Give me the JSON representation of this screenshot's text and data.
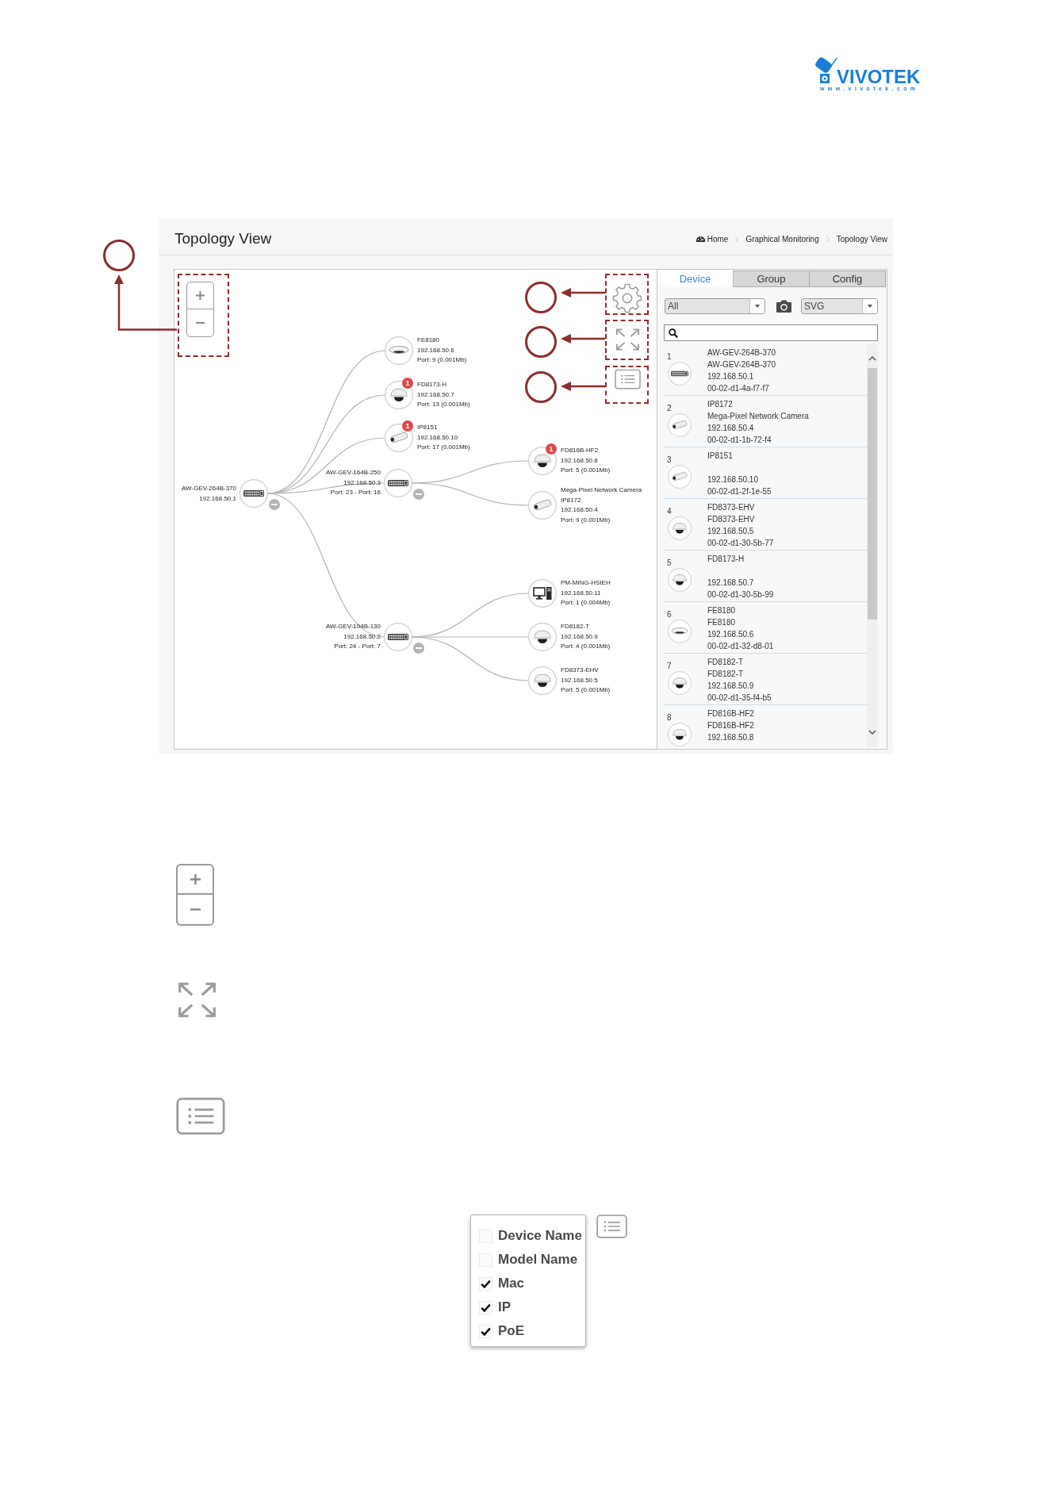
{
  "logo": {
    "wordmark": "VIVOTEK",
    "url": "www.vivotek.com"
  },
  "header": {
    "title": "Topology View",
    "breadcrumb": [
      {
        "label": "Home",
        "kind": "home"
      },
      {
        "label": "Graphical Monitoring",
        "kind": "link"
      },
      {
        "label": "Topology View",
        "kind": "link"
      }
    ]
  },
  "topology": {
    "kind": "switch",
    "name": "AW-GEV-264B-370",
    "ip": "192.168.50.1",
    "expanded": true,
    "children": [
      {
        "kind": "fisheye",
        "name": "FE8180",
        "ip": "192.168.50.6",
        "port": "Port: 9 (0.001Mb)"
      },
      {
        "kind": "dome",
        "name": "FD8173-H",
        "ip": "192.168.50.7",
        "port": "Port: 13 (0.001Mb)",
        "alerts": "1"
      },
      {
        "kind": "bullet",
        "name": "IP8151",
        "ip": "192.168.50.10",
        "port": "Port: 17 (0.001Mb)",
        "alerts": "1"
      },
      {
        "kind": "switch",
        "name": "AW-GEV-164B-250",
        "ip": "192.168.50.3",
        "port": "Port: 23 - Port: 16",
        "expanded": true,
        "children": [
          {
            "kind": "dome",
            "name": "FD816B-HF2",
            "ip": "192.168.50.8",
            "port": "Port: 5 (0.001Mb)",
            "alerts": "1"
          },
          {
            "kind": "bullet",
            "name": "Mega-Pixel Network Camera",
            "model": "IP8172",
            "ip": "192.168.50.4",
            "port": "Port: 9 (0.001Mb)"
          }
        ]
      },
      {
        "kind": "switch",
        "name": "AW-GEV-104B-130",
        "ip": "192.168.50.2",
        "port": "Port: 24 - Port: 7",
        "expanded": true,
        "children": [
          {
            "kind": "pc",
            "name": "PM-MING-HSIEH",
            "ip": "192.168.50.11",
            "port": "Port: 1 (0.004Mb)"
          },
          {
            "kind": "dome",
            "name": "FD8182-T",
            "ip": "192.168.50.9",
            "port": "Port: 4 (0.001Mb)"
          },
          {
            "kind": "dome",
            "name": "FD8373-EHV",
            "ip": "192.168.50.5",
            "port": "Port: 5 (0.001Mb)"
          }
        ]
      }
    ]
  },
  "device_panel": {
    "tabs": [
      {
        "label": "Device",
        "selected": true
      },
      {
        "label": "Group",
        "selected": false
      },
      {
        "label": "Config",
        "selected": false
      }
    ],
    "filter": {
      "value": "All"
    },
    "export_format": {
      "value": "SVG"
    },
    "devices": [
      {
        "number": "1",
        "kind": "switch",
        "model": "AW-GEV-264B-370",
        "name": "AW-GEV-264B-370",
        "ip": "192.168.50.1",
        "mac": "00-02-d1-4a-f7-f7"
      },
      {
        "number": "2",
        "kind": "bullet",
        "model": "IP8172",
        "name": "Mega-Pixel Network Camera",
        "ip": "192.168.50.4",
        "mac": "00-02-d1-1b-72-f4"
      },
      {
        "number": "3",
        "kind": "bullet",
        "model": "IP8151",
        "ip": "192.168.50.10",
        "mac": "00-02-d1-2f-1e-55"
      },
      {
        "number": "4",
        "kind": "dome",
        "model": "FD8373-EHV",
        "name": "FD8373-EHV",
        "ip": "192.168.50.5",
        "mac": "00-02-d1-30-5b-77"
      },
      {
        "number": "5",
        "kind": "dome",
        "model": "FD8173-H",
        "ip": "192.168.50.7",
        "mac": "00-02-d1-30-5b-99"
      },
      {
        "number": "6",
        "kind": "fisheye",
        "model": "FE8180",
        "name": "FE8180",
        "ip": "192.168.50.6",
        "mac": "00-02-d1-32-d8-01"
      },
      {
        "number": "7",
        "kind": "dome",
        "model": "FD8182-T",
        "name": "FD8182-T",
        "ip": "192.168.50.9",
        "mac": "00-02-d1-35-f4-b5"
      },
      {
        "number": "8",
        "kind": "dome",
        "model": "FD816B-HF2",
        "name": "FD816B-HF2",
        "ip": "192.168.50.8"
      }
    ]
  },
  "column_menu": {
    "items": [
      {
        "label": "Device Name",
        "checked": false
      },
      {
        "label": "Model Name",
        "checked": false
      },
      {
        "label": "Mac",
        "checked": true
      },
      {
        "label": "IP",
        "checked": true
      },
      {
        "label": "PoE",
        "checked": true
      }
    ]
  }
}
